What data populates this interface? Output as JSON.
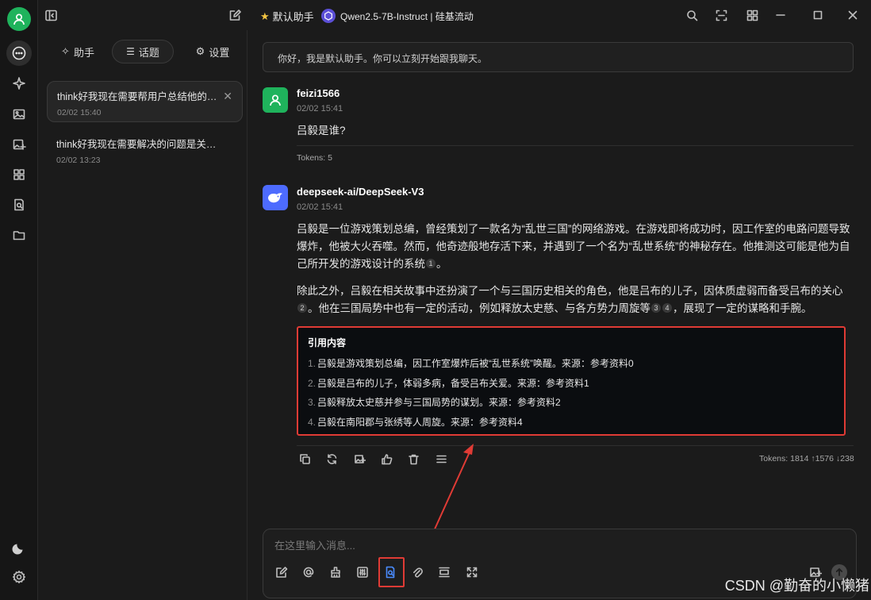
{
  "topbar": {
    "assistant_name": "默认助手",
    "model_name": "Qwen2.5-7B-Instruct | 硅基流动"
  },
  "side": {
    "tabs": [
      {
        "label": "助手",
        "icon": "sparkle-icon"
      },
      {
        "label": "话题",
        "icon": "list-icon"
      },
      {
        "label": "设置",
        "icon": "gear-icon"
      }
    ],
    "active_tab": "话题",
    "topics": [
      {
        "title": "think好我现在需要帮用户总结他的会...",
        "time": "02/02 15:40"
      },
      {
        "title": "think好我现在需要解决的问题是关于...",
        "time": "02/02 13:23"
      }
    ]
  },
  "chat": {
    "greeting": "你好，我是默认助手。你可以立刻开始跟我聊天。",
    "user_msg": {
      "name": "feizi1566",
      "time": "02/02 15:41",
      "text": "吕毅是谁?",
      "tokens": "Tokens: 5"
    },
    "bot_msg": {
      "name": "deepseek-ai/DeepSeek-V3",
      "time": "02/02 15:41",
      "p1": "吕毅是一位游戏策划总编，曾经策划了一款名为“乱世三国”的网络游戏。在游戏即将成功时，因工作室的电路问题导致爆炸，他被大火吞噬。然而，他奇迹般地存活下来，并遇到了一个名为“乱世系统”的神秘存在。他推测这可能是他为自己所开发的游戏设计的系统",
      "p1_end": "。",
      "p2a": "除此之外，吕毅在相关故事中还扮演了一个与三国历史相关的角色，他是吕布的儿子，因体质虚弱而备受吕布的关心",
      "p2b": "。他在三国局势中也有一定的活动，例如释放太史慈、与各方势力周旋等",
      "p2c": "，展现了一定的谋略和手腕。",
      "citations": [
        "1",
        "2",
        "3",
        "4"
      ],
      "ref_title": "引用内容",
      "refs": [
        {
          "n": "1.",
          "text": "吕毅是游戏策划总编，因工作室爆炸后被“乱世系统”唤醒。来源：参考资料0"
        },
        {
          "n": "2.",
          "text": "吕毅是吕布的儿子，体弱多病，备受吕布关爱。来源：参考资料1"
        },
        {
          "n": "3.",
          "text": "吕毅释放太史慈并参与三国局势的谋划。来源：参考资料2"
        },
        {
          "n": "4.",
          "text": "吕毅在南阳郡与张绣等人周旋。来源：参考资料4"
        }
      ],
      "tokens": "Tokens: 1814 ↑1576 ↓238"
    },
    "input_placeholder": "在这里输入消息..."
  },
  "watermark": "CSDN @勤奋的小懒猪",
  "colors": {
    "accent_green": "#1fb35c",
    "highlight_red": "#e03b35",
    "bot_avatar": "#4d6bfe"
  }
}
